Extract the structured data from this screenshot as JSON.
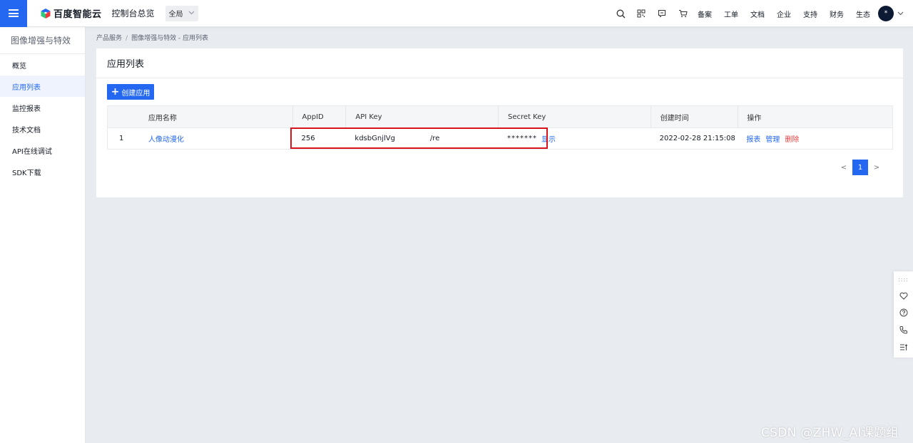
{
  "topbar": {
    "brand": "百度智能云",
    "console": "控制台总览",
    "region": "全局",
    "links": [
      "备案",
      "工单",
      "文档",
      "企业",
      "支持",
      "财务",
      "生态"
    ],
    "icons": [
      "search-icon",
      "qr-code-icon",
      "message-icon",
      "cart-icon"
    ],
    "avatar_text": "*"
  },
  "sidebar": {
    "title": "图像增强与特效",
    "items": [
      {
        "label": "概览"
      },
      {
        "label": "应用列表"
      },
      {
        "label": "监控报表"
      },
      {
        "label": "技术文档"
      },
      {
        "label": "API在线调试"
      },
      {
        "label": "SDK下载"
      }
    ],
    "active_index": 1
  },
  "breadcrumb": {
    "parent": "产品服务",
    "sep": "/",
    "current": "图像增强与特效 - 应用列表"
  },
  "main": {
    "title": "应用列表",
    "create_button": "创建应用",
    "table": {
      "headers": [
        "",
        "应用名称",
        "AppID",
        "API Key",
        "Secret Key",
        "创建时间",
        "操作"
      ],
      "rows": [
        {
          "index": "1",
          "name": "人像动漫化",
          "app_id": "256",
          "api_key_prefix": "kdsbGnjlVg",
          "api_key_suffix": "/re",
          "secret_key": "*******",
          "secret_action": "显示",
          "created": "2022-02-28 21:15:08",
          "actions": [
            "报表",
            "管理",
            "删除"
          ]
        }
      ]
    },
    "pagination": {
      "prev": "<",
      "current": "1",
      "next": ">"
    }
  },
  "watermark": "CSDN @ZHW_AI课题组",
  "colors": {
    "primary": "#2468f2",
    "danger": "#f33e3e",
    "highlight": "#d9131c"
  }
}
